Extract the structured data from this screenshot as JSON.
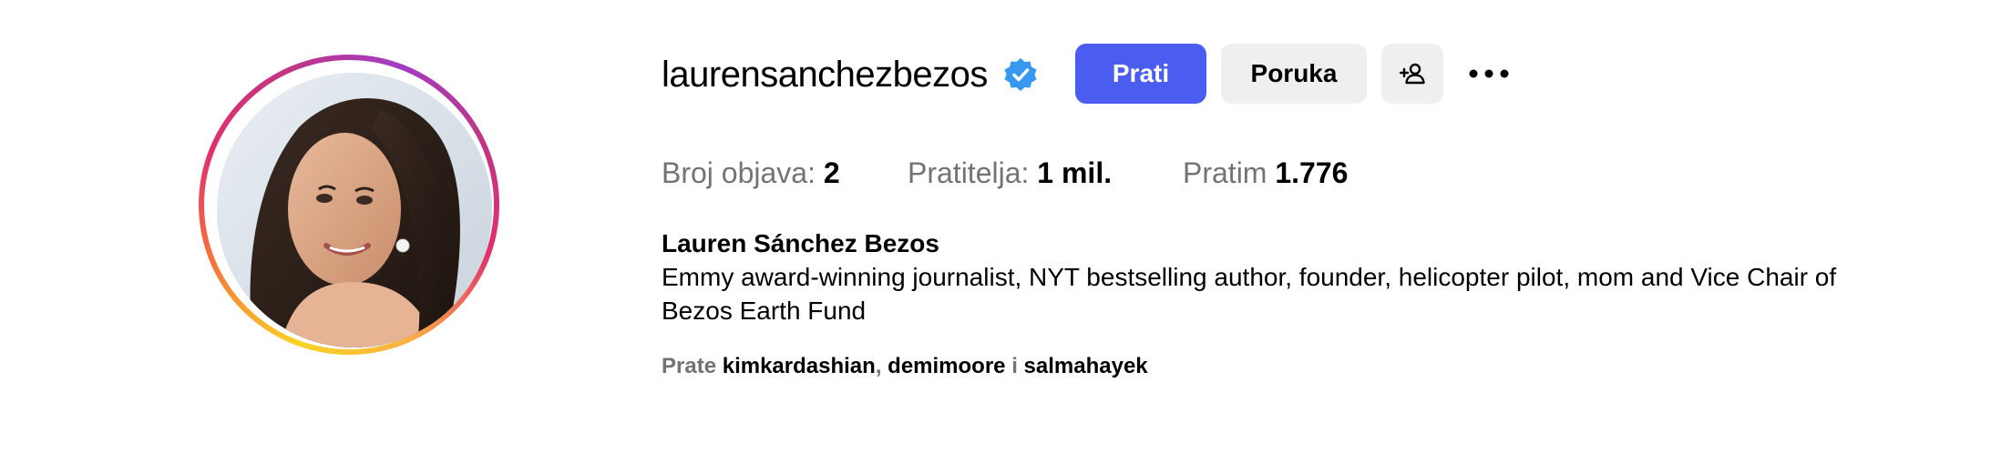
{
  "profile": {
    "username": "laurensanchezbezos",
    "verified": true,
    "full_name": "Lauren Sánchez Bezos",
    "bio": "Emmy award-winning journalist, NYT bestselling author, founder, helicopter pilot, mom and Vice Chair of Bezos Earth Fund"
  },
  "actions": {
    "follow_label": "Prati",
    "message_label": "Poruka",
    "suggest_icon": "person-add-icon",
    "more_icon": "more-options-icon"
  },
  "stats": {
    "posts_label": "Broj objava:",
    "posts_value": "2",
    "followers_label": "Pratitelja:",
    "followers_value": "1 mil.",
    "following_label": "Pratim",
    "following_value": "1.776"
  },
  "followed_by": {
    "prefix": "Prate",
    "accounts": [
      "kimkardashian",
      "demimoore",
      "salmahayek"
    ],
    "separator": ",",
    "conjunction": "i"
  },
  "colors": {
    "follow_button": "#4a5df0",
    "secondary_button": "#efeff2",
    "muted_text": "#737373",
    "verified_badge": "#3897f0"
  }
}
